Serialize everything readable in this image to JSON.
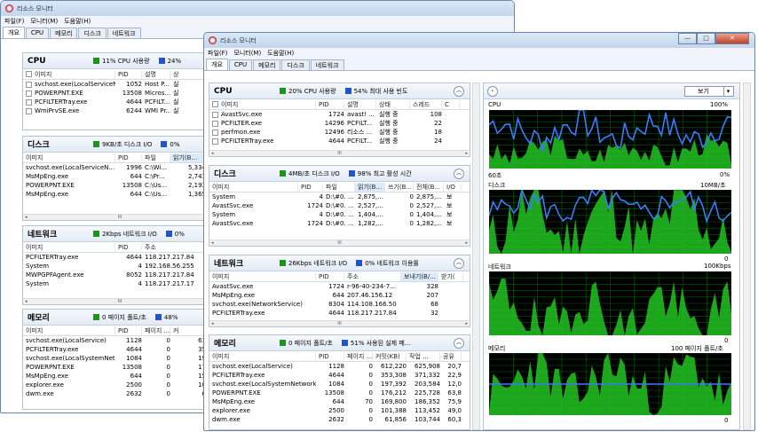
{
  "window_title": "리소스 모니터",
  "menu": [
    "파일(F)",
    "모니터(M)",
    "도움말(H)"
  ],
  "tabs": [
    "개요",
    "CPU",
    "메모리",
    "디스크",
    "네트워크"
  ],
  "back": {
    "cpu": {
      "title": "CPU",
      "ind1": "11% CPU 사용량",
      "ind2": "24%",
      "cols": [
        "이미지",
        "PID",
        "설명",
        "상"
      ],
      "rows": [
        [
          "svchost.exe(LocalServiceNetw...",
          "1052",
          "Host P...",
          "실"
        ],
        [
          "POWERPNT.EXE",
          "13508",
          "Micros...",
          "실"
        ],
        [
          "PCFILTERTray.exe",
          "4644",
          "PCFILT...",
          "실"
        ],
        [
          "WmiPrvSE.exe",
          "6244",
          "WMI Pr...",
          "실"
        ]
      ]
    },
    "disk": {
      "title": "디스크",
      "ind1": "9KB/초 디스크 I/O",
      "ind2": "0%",
      "cols": [
        "이미지",
        "PID",
        "파일",
        "읽기(B..."
      ],
      "rows": [
        [
          "svchost.exe(LocalServiceN...",
          "1996",
          "C:\\Wi...",
          "5,334"
        ],
        [
          "MsMpEng.exe",
          "644",
          "C:\\Pr...",
          "2,741"
        ],
        [
          "POWERPNT.EXE",
          "13508",
          "C:\\Us...",
          "2,193"
        ],
        [
          "MsMpEng.exe",
          "644",
          "C:\\Us...",
          "1,365"
        ]
      ]
    },
    "net": {
      "title": "네트워크",
      "ind1": "2Kbps 네트워크 I/O",
      "ind2": "0%",
      "cols": [
        "이미지",
        "PID",
        "주소"
      ],
      "rows": [
        [
          "PCFILTERTray.exe",
          "4644",
          "118.217.217.84"
        ],
        [
          "System",
          "4",
          "192.168.56.255"
        ],
        [
          "MWPGPFAgent.exe",
          "8052",
          "118.217.217.84"
        ],
        [
          "System",
          "4",
          "118.217.217.17"
        ]
      ]
    },
    "mem": {
      "title": "메모리",
      "ind1": "0 페이지 폴트/초",
      "ind2": "48%",
      "cols": [
        "이미지",
        "PID",
        "페이지 ...",
        "커"
      ],
      "rows": [
        [
          "svchost.exe(LocalService)",
          "1128",
          "0",
          "61"
        ],
        [
          "PCFILTERTray.exe",
          "4644",
          "0",
          "35"
        ],
        [
          "svchost.exe(LocalSystemNetwork...",
          "1084",
          "0",
          "19"
        ],
        [
          "POWERPNT.EXE",
          "13508",
          "0",
          "17"
        ],
        [
          "MsMpEng.exe",
          "644",
          "0",
          "15"
        ],
        [
          "explorer.exe",
          "2500",
          "0",
          "10"
        ],
        [
          "dwm.exe",
          "2632",
          "0",
          "6"
        ]
      ]
    }
  },
  "front": {
    "cpu": {
      "title": "CPU",
      "ind1": "20% CPU 사용량",
      "ind2": "54% 최대 사용 빈도",
      "cols": [
        "이미지",
        "PID",
        "설명",
        "상태",
        "스레드",
        "C"
      ],
      "rows": [
        [
          "AvastSvc.exe",
          "1724",
          "avast! ...",
          "실행 중",
          "108",
          ""
        ],
        [
          "PCFILTER.exe",
          "14296",
          "PCFILT...",
          "실행 중",
          "22",
          ""
        ],
        [
          "perfmon.exe",
          "12496",
          "리소스 ...",
          "실행 중",
          "18",
          ""
        ],
        [
          "PCFILTERTray.exe",
          "4644",
          "PCFILT...",
          "실행 중",
          "24",
          ""
        ]
      ]
    },
    "disk": {
      "title": "디스크",
      "ind1": "4MB/초 디스크 I/O",
      "ind2": "98% 최고 활성 시간",
      "cols": [
        "이미지",
        "PID",
        "파일",
        "읽기(B...",
        "쓰기(B...",
        "전체(B...",
        "I/O"
      ],
      "rows": [
        [
          "System",
          "4",
          "D:\\#0. ...",
          "2,875,...",
          "0",
          "2,875,...",
          "보"
        ],
        [
          "AvastSvc.exe",
          "1724",
          "D:\\#0. ...",
          "2,527,...",
          "0",
          "2,527,...",
          "보"
        ],
        [
          "System",
          "4",
          "D:\\#0. ...",
          "1,404,...",
          "0",
          "1,404,...",
          "보"
        ],
        [
          "AvastSvc.exe",
          "1724",
          "D:\\#0. ...",
          "1,282,...",
          "0",
          "1,282,...",
          "보"
        ]
      ]
    },
    "net": {
      "title": "네트워크",
      "ind1": "26Kbps 네트워크 I/O",
      "ind2": "0% 네트워크 이용률",
      "cols": [
        "이미지",
        "PID",
        "주소",
        "보내기(B/...",
        "받기("
      ],
      "rows": [
        [
          "AvastSvc.exe",
          "1724",
          "r-96-40-234-7...",
          "328",
          ""
        ],
        [
          "MsMpEng.exe",
          "644",
          "207.46.156.12",
          "207",
          ""
        ],
        [
          "svchost.exe(NetworkService)",
          "8304",
          "114.108.166.50",
          "68",
          ""
        ],
        [
          "PCFILTERTray.exe",
          "4644",
          "118.217.217.84",
          "32",
          ""
        ]
      ]
    },
    "mem": {
      "title": "메모리",
      "ind1": "0 페이지 폴트/초",
      "ind2": "51% 사용된 실제 메...",
      "cols": [
        "이미지",
        "PID",
        "페이지 ...",
        "커밋(KB)",
        "작업 ...",
        "공유"
      ],
      "rows": [
        [
          "svchost.exe(LocalService)",
          "1128",
          "0",
          "612,220",
          "625,908",
          "20,7"
        ],
        [
          "PCFILTERTray.exe",
          "4644",
          "0",
          "353,308",
          "371,332",
          "22,9"
        ],
        [
          "svchost.exe(LocalSystemNetwork...",
          "1084",
          "0",
          "197,392",
          "203,584",
          "12,0"
        ],
        [
          "POWERPNT.EXE",
          "13508",
          "0",
          "176,212",
          "225,728",
          "63,8"
        ],
        [
          "MsMpEng.exe",
          "644",
          "70",
          "169,800",
          "186,352",
          "75,9"
        ],
        [
          "explorer.exe",
          "2500",
          "0",
          "101,388",
          "113,452",
          "49,0"
        ],
        [
          "dwm.exe",
          "2632",
          "0",
          "61,856",
          "103,744",
          "60,3"
        ]
      ]
    }
  },
  "graphs": {
    "view_label": "보기",
    "cpu": {
      "title": "CPU",
      "max": "100%",
      "time": "60초",
      "min": "0%"
    },
    "disk": {
      "title": "디스크",
      "max": "10MB/초",
      "min": "0"
    },
    "net": {
      "title": "네트워크",
      "max": "100Kbps",
      "min": "0"
    },
    "mem": {
      "title": "메모리",
      "max": "100 페이지 폴트/초",
      "min": "0"
    }
  },
  "colors": {
    "graph_bg": "#000000",
    "graph_grid": "#006400",
    "usage_fill": "#22c322",
    "max_line": "#3a7bff"
  }
}
